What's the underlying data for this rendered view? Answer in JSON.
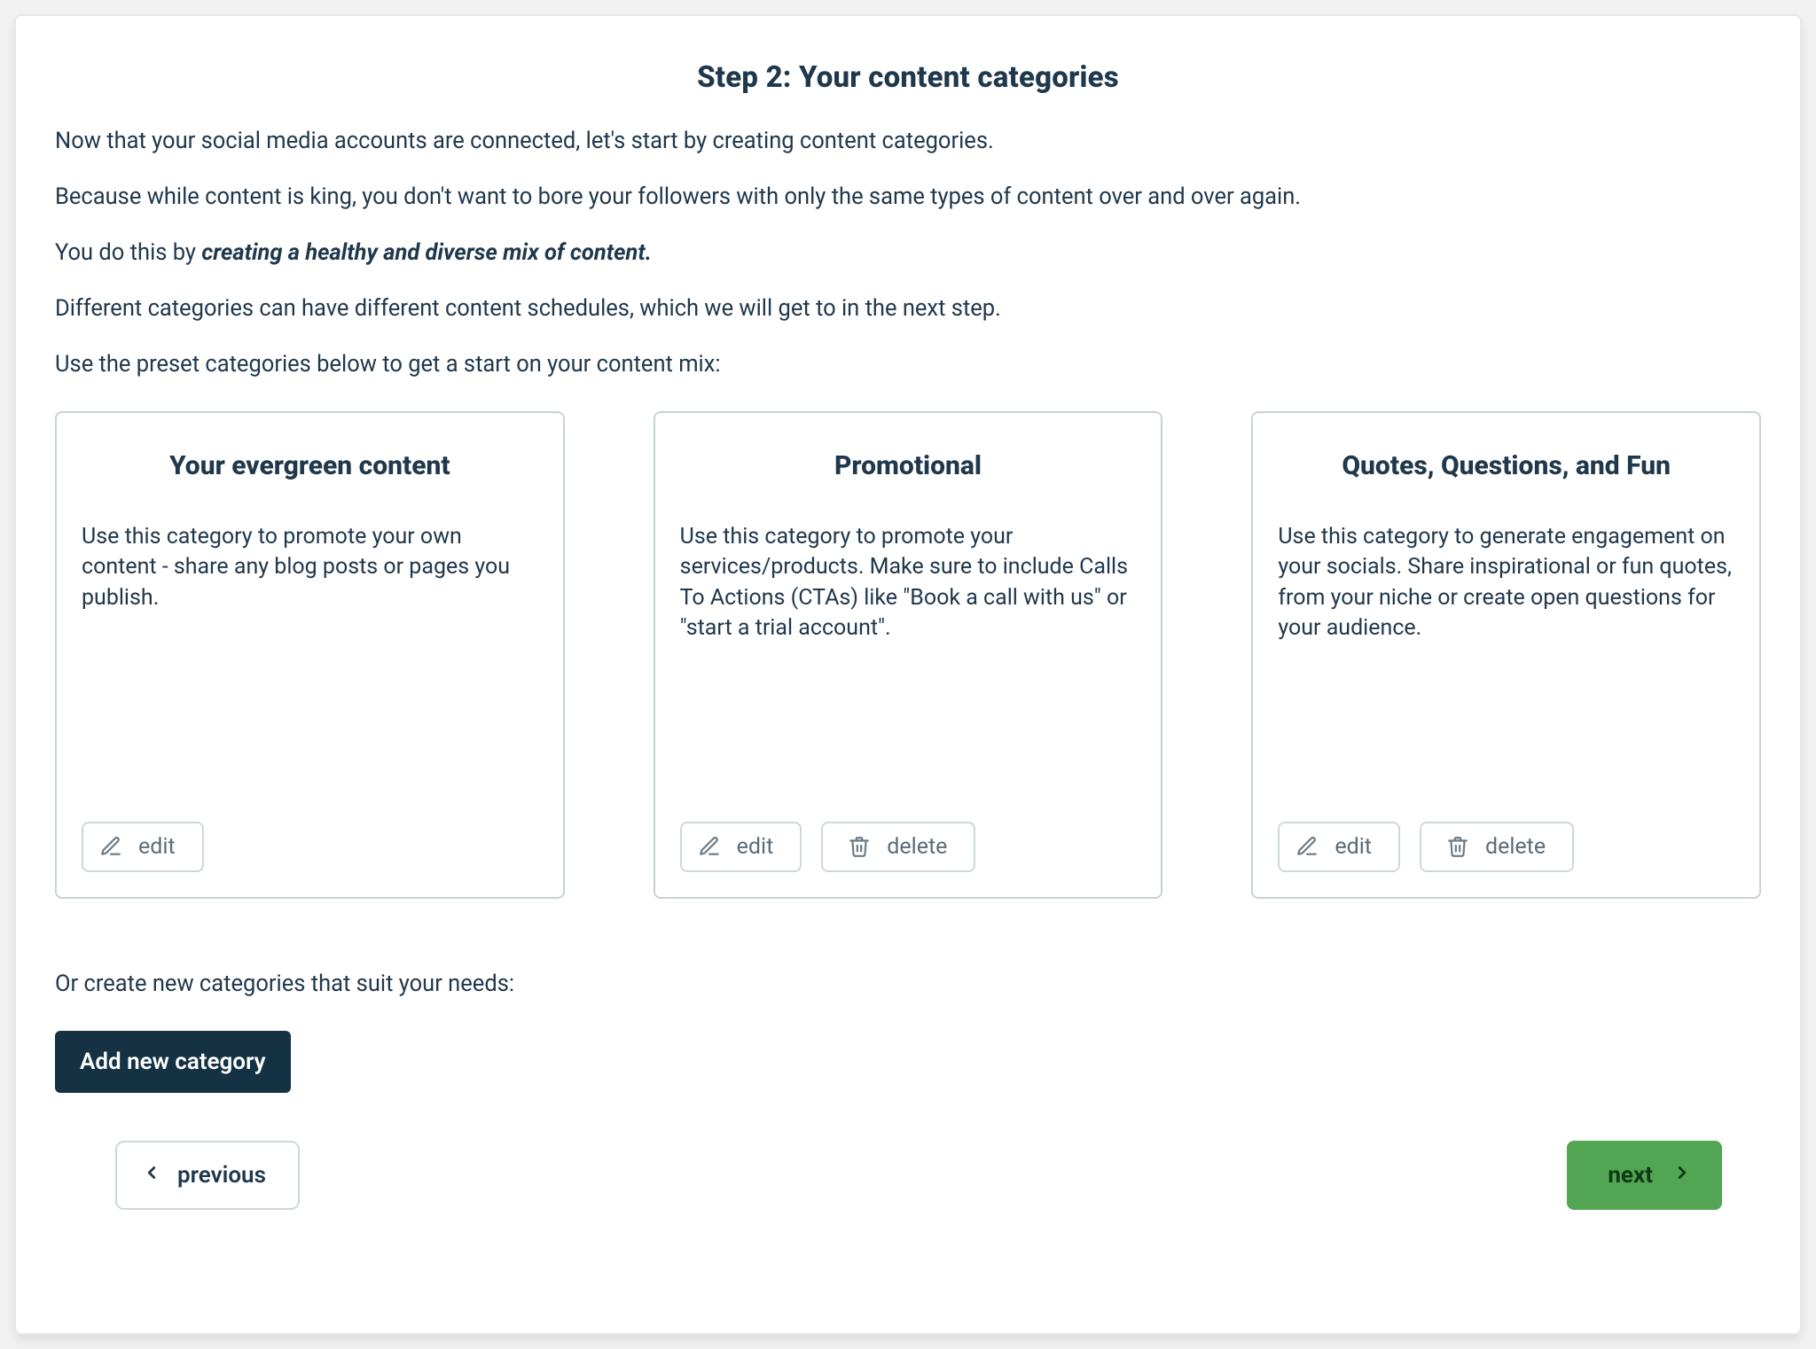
{
  "header": {
    "title": "Step 2: Your content categories"
  },
  "intro": {
    "p1": "Now that your social media accounts are connected, let's start by creating content categories.",
    "p2": "Because while content is king, you don't want to bore your followers with only the same types of content over and over again.",
    "p3_lead": "You do this by ",
    "p3_emph": "creating a healthy and diverse mix of content.",
    "p4": "Different categories can have different content schedules, which we will get to in the next step.",
    "p5": "Use the preset categories below to get a start on your content mix:"
  },
  "cards": [
    {
      "title": "Your evergreen content",
      "desc": "Use this category to promote your own content - share any blog posts or pages you publish.",
      "actions": [
        "edit"
      ]
    },
    {
      "title": "Promotional",
      "desc": "Use this category to promote your services/products. Make sure to include Calls To Actions (CTAs) like \"Book a call with us\" or \"start a trial account\".",
      "actions": [
        "edit",
        "delete"
      ]
    },
    {
      "title": "Quotes, Questions, and Fun",
      "desc": "Use this category to generate engagement on your socials. Share inspirational or fun quotes, from your niche or create open questions for your audience.",
      "actions": [
        "edit",
        "delete"
      ]
    }
  ],
  "below": {
    "hint": "Or create new categories that suit your needs:"
  },
  "buttons": {
    "edit": "edit",
    "delete": "delete",
    "add_category": "Add new category",
    "previous": "previous",
    "next": "next"
  },
  "colors": {
    "ink": "#1f3949",
    "primary_button_bg": "#143243",
    "next_button_bg": "#52a552",
    "border": "#cfd7dd"
  }
}
